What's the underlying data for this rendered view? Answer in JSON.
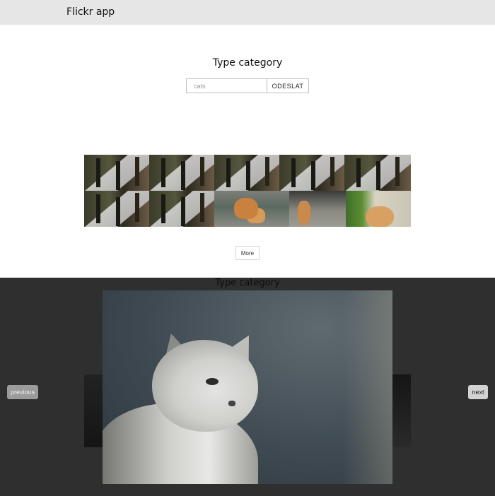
{
  "header": {
    "app_title": "Flickr app"
  },
  "search": {
    "heading": "Type category",
    "input_value": "",
    "placeholder": "cats",
    "submit_label": "ODESLAT"
  },
  "gallery": {
    "rows": [
      [
        "porch",
        "porch",
        "porch",
        "porch",
        "porch"
      ],
      [
        "porch",
        "porch",
        "cat-orange-lying",
        "cat-orange-sitting",
        "cat-orange-grass"
      ]
    ],
    "more_label": "More"
  },
  "lightbox": {
    "heading": "Type category",
    "previous_label": "previous",
    "next_label": "next",
    "image_subject": "grey-cat-portrait"
  },
  "colors": {
    "topbar": "#e6e6e6",
    "overlay": "#2f2f2f",
    "nav_button": "#9b9b9b"
  }
}
